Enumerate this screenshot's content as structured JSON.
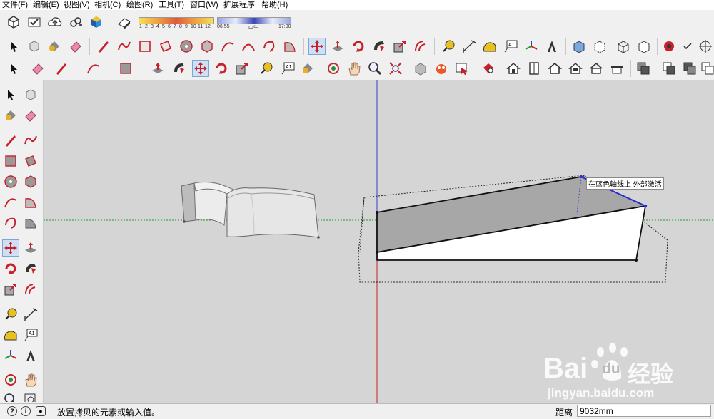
{
  "menu": [
    "文件(F)",
    "编辑(E)",
    "视图(V)",
    "相机(C)",
    "绘图(R)",
    "工具(T)",
    "窗口(W)",
    "扩展程序",
    "帮助(H)"
  ],
  "shadow": {
    "months": [
      "1",
      "2",
      "3",
      "4",
      "5",
      "6",
      "7",
      "8",
      "9",
      "10",
      "11",
      "12"
    ],
    "time_start": "06:55",
    "time_mid": "中午",
    "time_end": "17:00"
  },
  "tooltip": "在蓝色轴线上  外部激活",
  "status": {
    "message": "放置拷贝的元素或输入值。",
    "distance_label": "距离",
    "distance_value": "9032mm"
  },
  "watermark": {
    "brand": "Bai",
    "paw": "du",
    "site_name": "经验",
    "url": "jingyan.baidu.com"
  },
  "colors": {
    "accent_red": "#c8202a",
    "axis_blue": "#3a3ac8",
    "axis_red": "#c82020",
    "axis_green": "#22a022",
    "viewport_bg": "#d5d5d5"
  },
  "icons": {
    "row1": [
      "components-icon",
      "model-info-icon",
      "cloud-upload-icon",
      "link-icon",
      "extension-warehouse-icon",
      "shadow-toggle-icon"
    ],
    "row2": [
      "select-icon",
      "component-icon",
      "paint-bucket-icon",
      "eraser-icon",
      "pencil-icon",
      "freehand-icon",
      "rectangle-icon",
      "rotated-rectangle-icon",
      "circle-icon",
      "polygon-icon",
      "arc-icon",
      "two-point-arc-icon",
      "three-point-arc-icon",
      "pie-icon",
      "move-icon",
      "push-pull-icon",
      "rotate-icon",
      "follow-me-icon",
      "scale-icon",
      "offset-icon",
      "tape-measure-icon",
      "dimension-icon",
      "protractor-icon",
      "text-icon",
      "axes-icon",
      "3d-text-icon",
      "xray-icon",
      "back-edges-icon",
      "wireframe-icon",
      "hidden-line-icon",
      "shaded-icon",
      "position-camera-icon",
      "checkbox-icon",
      "walk-icon"
    ],
    "row3": [
      "select-icon",
      "eraser-icon",
      "pencil-icon",
      "arc-icon",
      "rectangle-icon",
      "push-pull-icon",
      "follow-me-icon",
      "move-icon",
      "rotate-icon",
      "scale-icon",
      "tape-measure-icon",
      "text-icon",
      "paint-bucket-icon",
      "orbit-icon",
      "pan-icon",
      "zoom-icon",
      "zoom-extents-icon",
      "previous-view-icon",
      "section-plane-icon",
      "display-section-icon",
      "iso-view-icon",
      "top-view-icon",
      "front-view-icon",
      "right-view-icon",
      "back-view-icon",
      "left-view-icon",
      "outer-shell-icon",
      "intersect-icon",
      "union-icon",
      "subtract-icon"
    ],
    "left": [
      "select-icon",
      "component-icon",
      "paint-bucket-icon",
      "eraser-icon",
      "pencil-icon",
      "freehand-icon",
      "rectangle-icon",
      "rotated-rectangle-icon",
      "circle-icon",
      "polygon-icon",
      "arc-icon",
      "pie-icon",
      "three-point-arc-icon",
      "two-point-arc-icon",
      "move-icon",
      "push-pull-icon",
      "rotate-icon",
      "follow-me-icon",
      "scale-icon",
      "offset-icon",
      "tape-measure-icon",
      "dimension-icon",
      "protractor-icon",
      "text-icon",
      "axes-icon",
      "3d-text-icon",
      "orbit-icon",
      "pan-icon",
      "zoom-icon",
      "zoom-window-icon"
    ]
  }
}
